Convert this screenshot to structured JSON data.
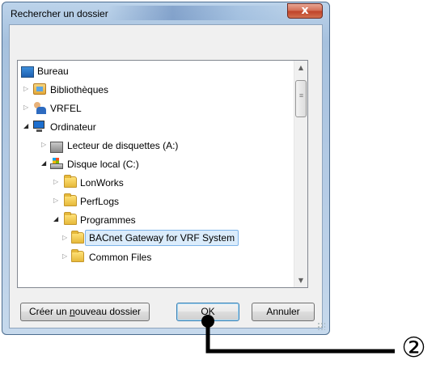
{
  "window": {
    "title": "Rechercher un dossier",
    "close_glyph": "x"
  },
  "tree": {
    "items": [
      {
        "label": "Bureau",
        "icon": "desktop-icon",
        "expander": "",
        "level": 0
      },
      {
        "label": "Bibliothèques",
        "icon": "library-icon",
        "expander": "collapsed",
        "level": 0
      },
      {
        "label": "VRFEL",
        "icon": "user-icon",
        "expander": "collapsed",
        "level": 0
      },
      {
        "label": "Ordinateur",
        "icon": "computer-icon",
        "expander": "expanded",
        "level": 0
      },
      {
        "label": "Lecteur de disquettes (A:)",
        "icon": "floppy-drive-icon",
        "expander": "collapsed",
        "level": 1
      },
      {
        "label": "Disque local (C:)",
        "icon": "local-disk-icon",
        "expander": "expanded",
        "level": 1
      },
      {
        "label": "LonWorks",
        "icon": "folder-icon",
        "expander": "collapsed",
        "level": 2
      },
      {
        "label": "PerfLogs",
        "icon": "folder-icon",
        "expander": "collapsed",
        "level": 2
      },
      {
        "label": "Programmes",
        "icon": "folder-icon",
        "expander": "expanded",
        "level": 2
      },
      {
        "label": "BACnet Gateway for VRF System",
        "icon": "folder-icon",
        "expander": "collapsed",
        "level": 3,
        "selected": true
      },
      {
        "label": "Common Files",
        "icon": "folder-icon",
        "expander": "collapsed",
        "level": 3
      }
    ]
  },
  "buttons": {
    "new_folder_pre": "Créer un ",
    "new_folder_accel": "n",
    "new_folder_post": "ouveau dossier",
    "ok": "OK",
    "cancel": "Annuler"
  },
  "annotation": {
    "number": "②",
    "line_color": "#000000"
  },
  "colors": {
    "selection_bg": "#dbecfb",
    "selection_border": "#7eb4ea",
    "close_button": "#c0442a"
  }
}
